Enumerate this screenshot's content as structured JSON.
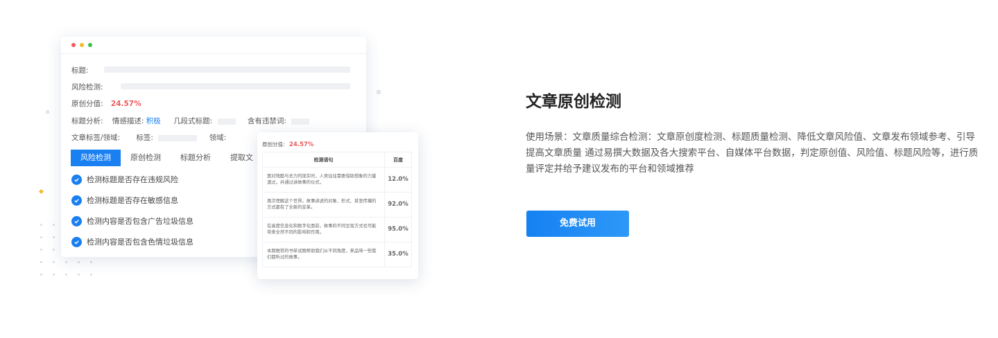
{
  "window": {
    "traffic_lights": [
      "#f35b5b",
      "#f5bb24",
      "#38c04c"
    ],
    "fields": {
      "title_label": "标题:",
      "risk_label": "风险检测:",
      "originality_label": "原创分值:",
      "originality_value": "24.57%",
      "title_analysis_label": "标题分析:",
      "sentiment_label": "情感描述:",
      "sentiment_value": "积极",
      "paragraph_title_label": "几段式标题:",
      "banned_words_label": "含有违禁词:",
      "tags_domain_label": "文章标签/领域:",
      "tags_label": "标签:",
      "domain_label": "领域:"
    },
    "tabs": [
      "风险检测",
      "原创检测",
      "标题分析",
      "提取文"
    ],
    "active_tab": 0,
    "checks": [
      "检测标题是否存在违规风险",
      "检测标题是否存在敏感信息",
      "检测内容是否包含广告垃圾信息",
      "检测内容是否包含色情垃圾信息"
    ]
  },
  "overlay": {
    "originality_label": "原创分值:",
    "originality_value": "24.57%",
    "headers": [
      "检测语句",
      "百度"
    ],
    "rows": [
      {
        "sentence": "面对残酷与无力的现实时，人类往往需要借助想象的力量渡过，并通过讲故事的仪式，",
        "score": "12.0%",
        "color": "#1a92f0"
      },
      {
        "sentence": "再次理解这个世界。故事讲述的对象、形式、甚至传播的方式都有了全新的变革。",
        "score": "92.0%",
        "color": "#1a92f0"
      },
      {
        "sentence": "在高度信息化和数字化面前，故事的不同呈现方式也可能带来全然不同的影响和作用。",
        "score": "95.0%",
        "color": "#ef5a5a"
      },
      {
        "sentence": "本期推荐的书单试图帮助我们从不同角度，来品味一些我们都听过的故事。",
        "score": "35.0%",
        "color": "#1a92f0"
      }
    ]
  },
  "content": {
    "title": "文章原创检测",
    "description": "使用场景：文章质量综合检测：文章原创度检测、标题质量检测、降低文章风险值、文章发布领域参考、引导提高文章质量 通过易撰大数据及各大搜索平台、自媒体平台数据，判定原创值、风险值、标题风险等，进行质量评定并给予建议发布的平台和领域推荐",
    "cta_label": "免费试用"
  },
  "colors": {
    "accent": "#1a7ff0",
    "danger": "#ef5a5a",
    "decor_yellow": "#f5bb24",
    "decor_gray": "#e3e6eb"
  }
}
